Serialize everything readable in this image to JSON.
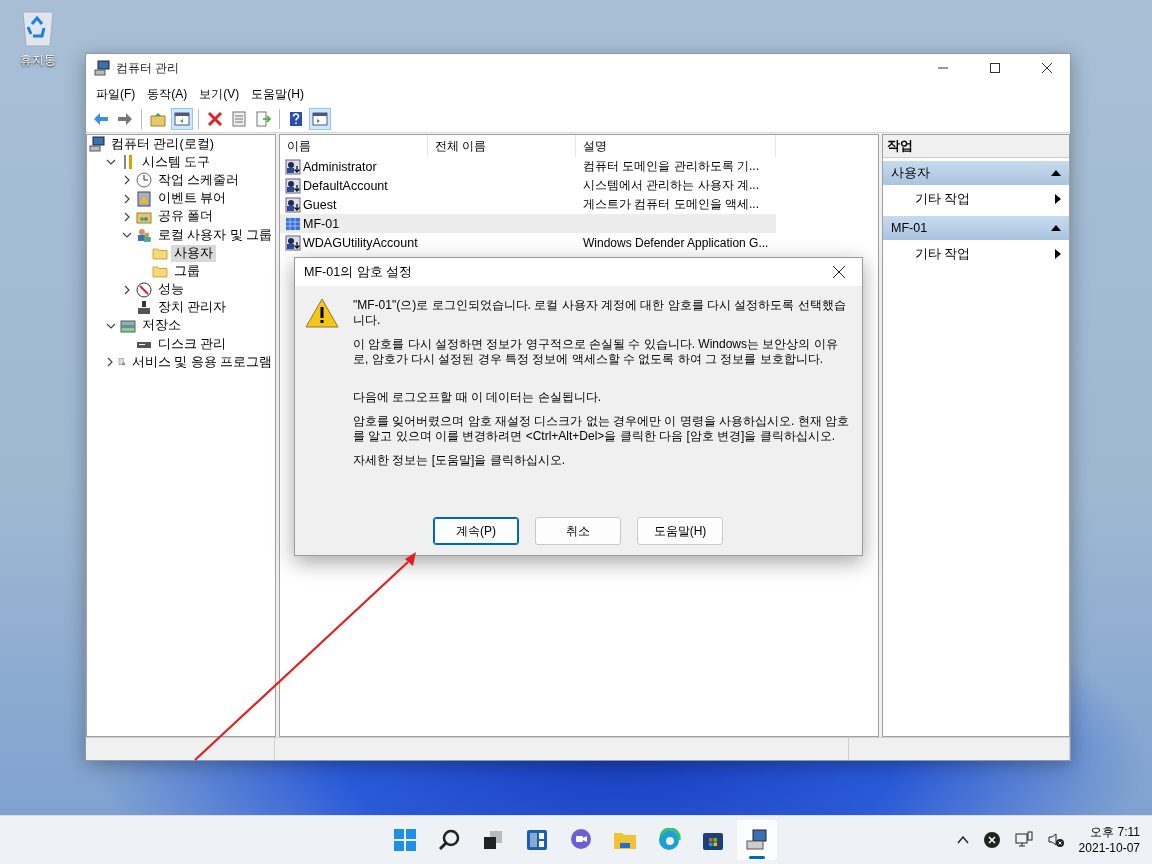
{
  "desktop_icons": [
    {
      "label": "휴지통"
    }
  ],
  "window": {
    "title": "컴퓨터 관리"
  },
  "menu": [
    "파일(F)",
    "동작(A)",
    "보기(V)",
    "도움말(H)"
  ],
  "toolbar": [
    [
      {
        "on": false
      },
      {
        "on": false
      }
    ],
    [
      {
        "on": false
      },
      {
        "on": true
      }
    ],
    [
      {
        "on": false
      },
      {
        "on": false
      },
      {
        "on": false
      }
    ],
    [
      {
        "on": false
      },
      {
        "on": true
      }
    ]
  ],
  "tree": [
    {
      "label": "컴퓨터 관리(로컬)",
      "kind": "computer",
      "selected": false,
      "children": [
        {
          "label": "시스템 도구",
          "kind": "tools",
          "expanded": true,
          "selected": false,
          "children": [
            {
              "label": "작업 스케줄러",
              "kind": "clock",
              "expanded": false,
              "selected": false
            },
            {
              "label": "이벤트 뷰어",
              "kind": "event",
              "expanded": false,
              "selected": false
            },
            {
              "label": "공유 폴더",
              "kind": "share",
              "expanded": false,
              "selected": false
            },
            {
              "label": "로컬 사용자 및 그룹",
              "kind": "users",
              "expanded": true,
              "selected": false,
              "children": [
                {
                  "label": "사용자",
                  "kind": "folder",
                  "selected": true
                },
                {
                  "label": "그룹",
                  "kind": "folder",
                  "selected": false
                }
              ]
            },
            {
              "label": "성능",
              "kind": "perf",
              "expanded": false,
              "selected": false
            },
            {
              "label": "장치 관리자",
              "kind": "device",
              "selected": false
            }
          ]
        },
        {
          "label": "저장소",
          "kind": "storage",
          "expanded": true,
          "selected": false,
          "children": [
            {
              "label": "디스크 관리",
              "kind": "disk",
              "selected": false
            }
          ]
        },
        {
          "label": "서비스 및 응용 프로그램",
          "kind": "services",
          "expanded": false,
          "selected": false
        }
      ]
    }
  ],
  "table": {
    "columns": [
      "이름",
      "전체 이름",
      "설명"
    ],
    "rows": [
      {
        "name": "Administrator",
        "kind": "user",
        "description": "컴퓨터 도메인을 관리하도록 기...",
        "selected": false
      },
      {
        "name": "DefaultAccount",
        "kind": "user",
        "description": "시스템에서 관리하는 사용자 계...",
        "selected": false
      },
      {
        "name": "Guest",
        "kind": "user",
        "description": "게스트가 컴퓨터 도메인을 액세...",
        "selected": false
      },
      {
        "name": "MF-01",
        "kind": "changed",
        "selected": true
      },
      {
        "name": "WDAGUtilityAccount",
        "kind": "user",
        "description": "Windows Defender Application G...",
        "selected": false
      }
    ]
  },
  "actions": {
    "title": "작업",
    "sections": [
      {
        "title": "사용자",
        "expanded": true,
        "items": [
          "기타 작업"
        ]
      },
      {
        "title": "MF-01",
        "expanded": true,
        "items": [
          "기타 작업"
        ]
      }
    ]
  },
  "dialog": {
    "title": "MF-01의 암호 설정",
    "paragraphs": [
      "\"MF-01\"(으)로 로그인되었습니다. 로컬 사용자 계정에 대한 암호를 다시 설정하도록 선택했습니다.",
      "이 암호를 다시 설정하면 정보가 영구적으로 손실될 수 있습니다. Windows는 보안상의 이유로, 암호가 다시 설정된 경우 특정 정보에 액세스할 수 없도록 하여 그 정보를 보호합니다.",
      "다음에 로그오프할 때 이 데이터는 손실됩니다.",
      "암호를 잊어버렸으며 암호 재설정 디스크가 없는 경우에만 이 명령을 사용하십시오. 현재 암호를 알고 있으며 이를 변경하려면 <Ctrl+Alt+Del>을 클릭한 다음 [암호 변경]을 클릭하십시오.",
      "자세한 정보는 [도움말]을 클릭하십시오."
    ],
    "buttons": [
      {
        "label": "계속(P)",
        "default": true
      },
      {
        "label": "취소",
        "default": false
      },
      {
        "label": "도움말(H)",
        "default": false
      }
    ]
  },
  "taskbar": {
    "apps": [
      {
        "active": false
      },
      {
        "active": false
      },
      {
        "active": false
      },
      {
        "active": false
      },
      {
        "active": false
      },
      {
        "active": false
      },
      {
        "active": false
      },
      {
        "active": false
      },
      {
        "active": true
      }
    ],
    "time": "오후 7:11",
    "date": "2021-10-07"
  }
}
